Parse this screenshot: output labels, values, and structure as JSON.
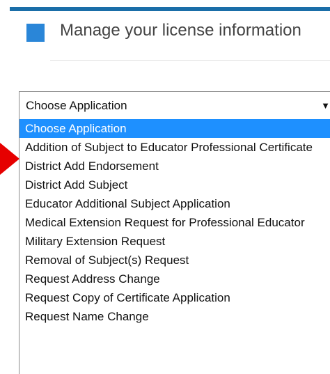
{
  "header": {
    "title": "Manage your license information"
  },
  "select": {
    "current_value": "Choose Application",
    "arrow_icon": "triangle-down-icon"
  },
  "dropdown": {
    "options": [
      {
        "label": "Choose Application",
        "selected": true
      },
      {
        "label": "Addition of Subject to Educator Professional Certificate",
        "selected": false
      },
      {
        "label": "District Add Endorsement",
        "selected": false
      },
      {
        "label": "District Add Subject",
        "selected": false
      },
      {
        "label": "Educator Additional Subject Application",
        "selected": false
      },
      {
        "label": "Medical Extension Request for Professional Educator",
        "selected": false
      },
      {
        "label": "Military Extension Request",
        "selected": false
      },
      {
        "label": "Removal of Subject(s) Request",
        "selected": false
      },
      {
        "label": "Request Address Change",
        "selected": false
      },
      {
        "label": "Request Copy of Certificate Application",
        "selected": false
      },
      {
        "label": "Request Name Change",
        "selected": false
      }
    ]
  },
  "colors": {
    "accent_bar": "#1a6ea8",
    "header_square": "#2a86d8",
    "selection": "#1e90ff",
    "pointer": "#e60000"
  }
}
